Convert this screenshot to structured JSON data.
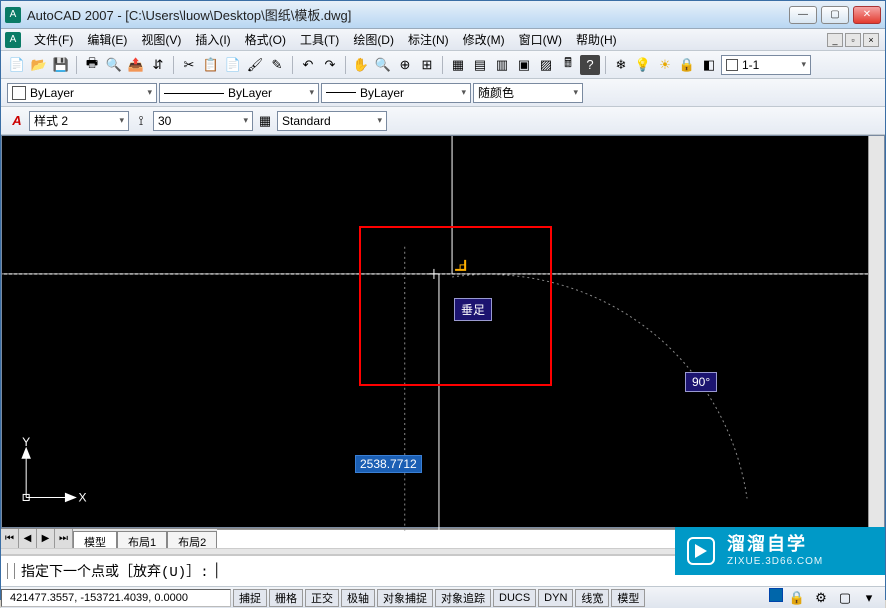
{
  "title": "AutoCAD 2007 - [C:\\Users\\luow\\Desktop\\图纸\\模板.dwg]",
  "appicon_text": "A",
  "menu": {
    "file": "文件(F)",
    "edit": "编辑(E)",
    "view": "视图(V)",
    "insert": "插入(I)",
    "format": "格式(O)",
    "tools": "工具(T)",
    "draw": "绘图(D)",
    "dimension": "标注(N)",
    "modify": "修改(M)",
    "window": "窗口(W)",
    "help": "帮助(H)"
  },
  "toolbar_icons": {
    "new": "📄",
    "open": "📂",
    "save": "💾",
    "plot": "🖶",
    "preview": "🔍",
    "publish": "📤",
    "send": "⇵",
    "cut": "✂",
    "copy": "📋",
    "paste": "📄",
    "matchprop": "🖌",
    "eraser": "✎",
    "undo": "↶",
    "redo": "↷",
    "pan": "✋",
    "zoomrt": "🔍",
    "zoomin": "⊕",
    "zoomwin": "⊞",
    "props": "▦",
    "dc": "▤",
    "tp": "▥",
    "sheet": "▣",
    "markup": "▨",
    "calc": "🖩",
    "help": "?",
    "layeriso": "❄",
    "bulb": "💡",
    "sun": "☀",
    "lock": "🔒",
    "color": "◧"
  },
  "layer_combo": "1-1",
  "props": {
    "layer": "ByLayer",
    "linetype": "ByLayer",
    "lineweight": "ByLayer",
    "color": "随颜色"
  },
  "style_row": {
    "textstyle": "样式 2",
    "dimscale": "30",
    "dimstyle": "Standard"
  },
  "canvas": {
    "tooltip": "垂足",
    "angle": "90°",
    "dyn_value": "2538.7712",
    "ucs_y": "Y",
    "ucs_x": "X"
  },
  "tabs": {
    "model": "模型",
    "layout1": "布局1",
    "layout2": "布局2"
  },
  "cmd": {
    "prompt": "指定下一个点或［放弃(U)］:"
  },
  "status": {
    "coords": "421477.3557, -153721.4039, 0.0000",
    "snap": "捕捉",
    "grid": "栅格",
    "ortho": "正交",
    "polar": "极轴",
    "osnap": "对象捕捉",
    "otrack": "对象追踪",
    "ducs": "DUCS",
    "dyn": "DYN",
    "lwt": "线宽",
    "modelbtn": "模型"
  },
  "watermark": {
    "brand": "溜溜自学",
    "url": "ZIXUE.3D66.COM"
  }
}
